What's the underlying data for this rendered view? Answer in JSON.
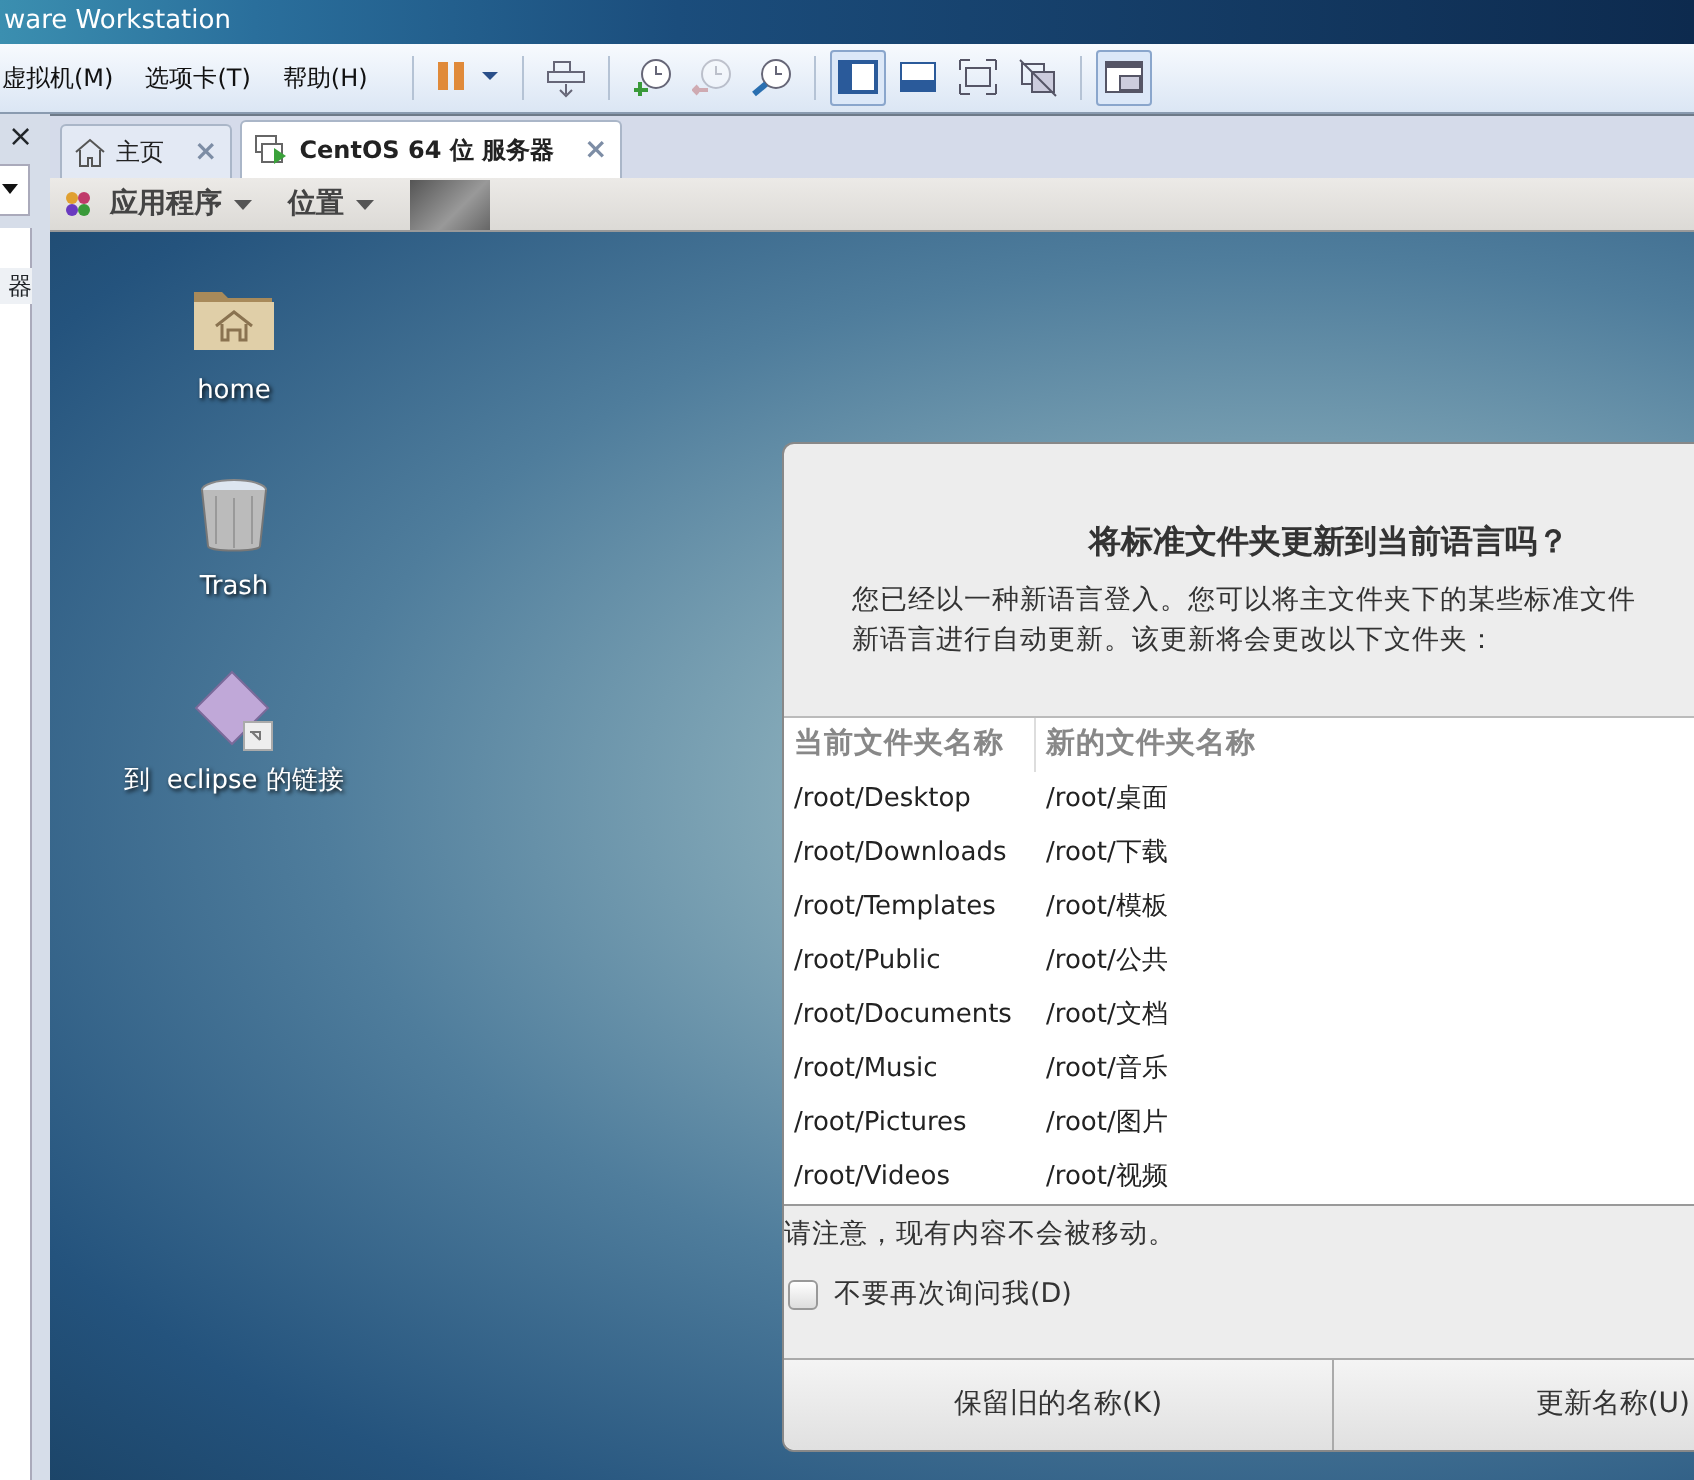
{
  "window": {
    "title": "ware Workstation"
  },
  "menu": [
    "虚拟机(M)",
    "选项卡(T)",
    "帮助(H)"
  ],
  "toolbar": [
    {
      "kind": "pause",
      "selected": false,
      "disabled": false
    },
    {
      "kind": "send",
      "selected": false,
      "disabled": false
    },
    {
      "kind": "snapshot-take",
      "selected": false,
      "disabled": false
    },
    {
      "kind": "snapshot-revert",
      "selected": false,
      "disabled": true
    },
    {
      "kind": "snapshot-manage",
      "selected": false,
      "disabled": false
    },
    {
      "kind": "view-sidebar",
      "selected": true,
      "disabled": false
    },
    {
      "kind": "view-console",
      "selected": false,
      "disabled": false
    },
    {
      "kind": "fullscreen",
      "selected": false,
      "disabled": false
    },
    {
      "kind": "unity",
      "selected": false,
      "disabled": false
    },
    {
      "kind": "thumbnails",
      "selected": true,
      "disabled": false
    }
  ],
  "sidebar": {
    "close": "×",
    "item": "器"
  },
  "tabs": [
    {
      "label": "主页",
      "kind": "home",
      "selected": false,
      "close": "×"
    },
    {
      "label": "CentOS 64 位 服务器",
      "kind": "vm",
      "selected": true,
      "close": "×"
    }
  ],
  "panel": {
    "menus": [
      "应用程序",
      "位置"
    ]
  },
  "desktop_icons": [
    {
      "kind": "folder",
      "label": "home"
    },
    {
      "kind": "trash",
      "label": "Trash"
    },
    {
      "kind": "link",
      "label": "到  eclipse 的链接"
    }
  ],
  "dialog": {
    "title": "将标准文件夹更新到当前语言吗？",
    "message_lines": [
      "您已经以一种新语言登入。您可以将主文件夹下的某些标准文件",
      "新语言进行自动更新。该更新将会更改以下文件夹："
    ],
    "table": {
      "columns": [
        "当前文件夹名称",
        "新的文件夹名称"
      ],
      "rows": [
        [
          "/root/Desktop",
          "/root/桌面"
        ],
        [
          "/root/Downloads",
          "/root/下载"
        ],
        [
          "/root/Templates",
          "/root/模板"
        ],
        [
          "/root/Public",
          "/root/公共"
        ],
        [
          "/root/Documents",
          "/root/文档"
        ],
        [
          "/root/Music",
          "/root/音乐"
        ],
        [
          "/root/Pictures",
          "/root/图片"
        ],
        [
          "/root/Videos",
          "/root/视频"
        ]
      ]
    },
    "note": "请注意，现有内容不会被移动。",
    "checkbox": {
      "label": "不要再次询问我(D)",
      "checked": false
    },
    "buttons": [
      "保留旧的名称(K)",
      "更新名称(U)"
    ]
  }
}
